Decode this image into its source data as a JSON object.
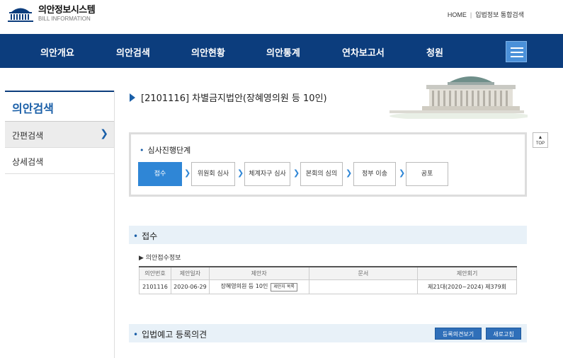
{
  "header": {
    "logo_title": "의안정보시스템",
    "logo_sub": "BILL INFORMATION",
    "util_home": "HOME",
    "util_sep": "|",
    "util_link": "입법정보 통합검색"
  },
  "nav": {
    "items": [
      "의안개요",
      "의안검색",
      "의안현황",
      "의안통계",
      "연차보고서",
      "청원"
    ]
  },
  "sidebar": {
    "title": "의안검색",
    "items": [
      "간편검색",
      "상세검색"
    ]
  },
  "page": {
    "title": "[2101116] 차별금지법안(장혜영의원 등 10인)"
  },
  "stage": {
    "label": "심사진행단계",
    "steps": [
      "접수",
      "위원회 심사",
      "체계자구 심사",
      "본회의 심의",
      "정부 이송",
      "공포"
    ]
  },
  "top_button": "TOP",
  "receipt": {
    "section": "접수",
    "sub": "▶ 의안접수정보",
    "headers": [
      "의안번호",
      "제안일자",
      "제안자",
      "문서",
      "제안회기"
    ],
    "row": {
      "bill_no": "2101116",
      "date": "2020-06-29",
      "proposer": "장혜영의원 등 10인",
      "proposer_btn": "제안자 목록",
      "doc": "",
      "session": "제21대(2020~2024) 제379회"
    }
  },
  "opinion": {
    "section": "입법예고 등록의견",
    "btn_view": "등록의견보기",
    "btn_refresh": "새로고침"
  },
  "colors": {
    "nav_bg": "#0c3d7d",
    "accent": "#2f86d6",
    "section_bg": "#e8f1f8"
  }
}
